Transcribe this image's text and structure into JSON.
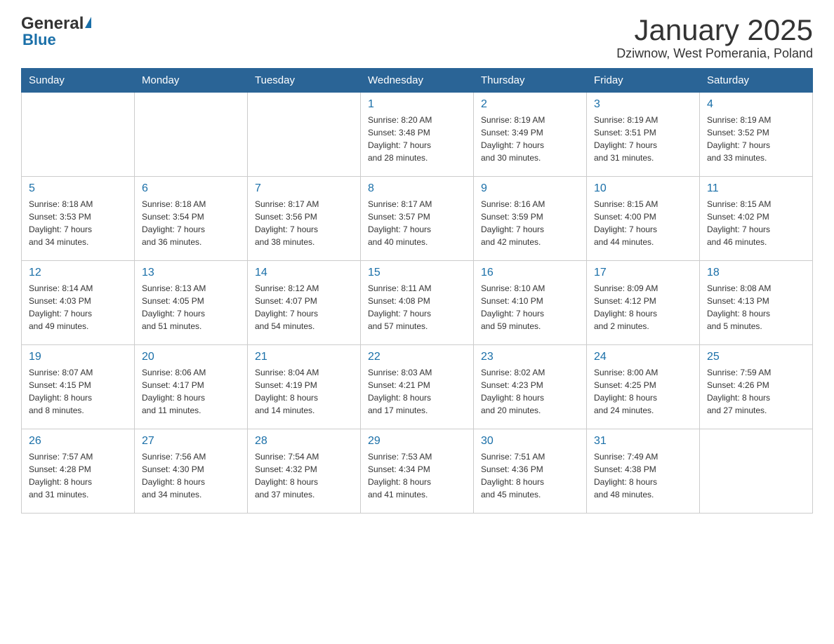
{
  "header": {
    "logo_general": "General",
    "logo_blue": "Blue",
    "title": "January 2025",
    "subtitle": "Dziwnow, West Pomerania, Poland"
  },
  "days_of_week": [
    "Sunday",
    "Monday",
    "Tuesday",
    "Wednesday",
    "Thursday",
    "Friday",
    "Saturday"
  ],
  "weeks": [
    {
      "days": [
        {
          "num": "",
          "info": ""
        },
        {
          "num": "",
          "info": ""
        },
        {
          "num": "",
          "info": ""
        },
        {
          "num": "1",
          "info": "Sunrise: 8:20 AM\nSunset: 3:48 PM\nDaylight: 7 hours\nand 28 minutes."
        },
        {
          "num": "2",
          "info": "Sunrise: 8:19 AM\nSunset: 3:49 PM\nDaylight: 7 hours\nand 30 minutes."
        },
        {
          "num": "3",
          "info": "Sunrise: 8:19 AM\nSunset: 3:51 PM\nDaylight: 7 hours\nand 31 minutes."
        },
        {
          "num": "4",
          "info": "Sunrise: 8:19 AM\nSunset: 3:52 PM\nDaylight: 7 hours\nand 33 minutes."
        }
      ]
    },
    {
      "days": [
        {
          "num": "5",
          "info": "Sunrise: 8:18 AM\nSunset: 3:53 PM\nDaylight: 7 hours\nand 34 minutes."
        },
        {
          "num": "6",
          "info": "Sunrise: 8:18 AM\nSunset: 3:54 PM\nDaylight: 7 hours\nand 36 minutes."
        },
        {
          "num": "7",
          "info": "Sunrise: 8:17 AM\nSunset: 3:56 PM\nDaylight: 7 hours\nand 38 minutes."
        },
        {
          "num": "8",
          "info": "Sunrise: 8:17 AM\nSunset: 3:57 PM\nDaylight: 7 hours\nand 40 minutes."
        },
        {
          "num": "9",
          "info": "Sunrise: 8:16 AM\nSunset: 3:59 PM\nDaylight: 7 hours\nand 42 minutes."
        },
        {
          "num": "10",
          "info": "Sunrise: 8:15 AM\nSunset: 4:00 PM\nDaylight: 7 hours\nand 44 minutes."
        },
        {
          "num": "11",
          "info": "Sunrise: 8:15 AM\nSunset: 4:02 PM\nDaylight: 7 hours\nand 46 minutes."
        }
      ]
    },
    {
      "days": [
        {
          "num": "12",
          "info": "Sunrise: 8:14 AM\nSunset: 4:03 PM\nDaylight: 7 hours\nand 49 minutes."
        },
        {
          "num": "13",
          "info": "Sunrise: 8:13 AM\nSunset: 4:05 PM\nDaylight: 7 hours\nand 51 minutes."
        },
        {
          "num": "14",
          "info": "Sunrise: 8:12 AM\nSunset: 4:07 PM\nDaylight: 7 hours\nand 54 minutes."
        },
        {
          "num": "15",
          "info": "Sunrise: 8:11 AM\nSunset: 4:08 PM\nDaylight: 7 hours\nand 57 minutes."
        },
        {
          "num": "16",
          "info": "Sunrise: 8:10 AM\nSunset: 4:10 PM\nDaylight: 7 hours\nand 59 minutes."
        },
        {
          "num": "17",
          "info": "Sunrise: 8:09 AM\nSunset: 4:12 PM\nDaylight: 8 hours\nand 2 minutes."
        },
        {
          "num": "18",
          "info": "Sunrise: 8:08 AM\nSunset: 4:13 PM\nDaylight: 8 hours\nand 5 minutes."
        }
      ]
    },
    {
      "days": [
        {
          "num": "19",
          "info": "Sunrise: 8:07 AM\nSunset: 4:15 PM\nDaylight: 8 hours\nand 8 minutes."
        },
        {
          "num": "20",
          "info": "Sunrise: 8:06 AM\nSunset: 4:17 PM\nDaylight: 8 hours\nand 11 minutes."
        },
        {
          "num": "21",
          "info": "Sunrise: 8:04 AM\nSunset: 4:19 PM\nDaylight: 8 hours\nand 14 minutes."
        },
        {
          "num": "22",
          "info": "Sunrise: 8:03 AM\nSunset: 4:21 PM\nDaylight: 8 hours\nand 17 minutes."
        },
        {
          "num": "23",
          "info": "Sunrise: 8:02 AM\nSunset: 4:23 PM\nDaylight: 8 hours\nand 20 minutes."
        },
        {
          "num": "24",
          "info": "Sunrise: 8:00 AM\nSunset: 4:25 PM\nDaylight: 8 hours\nand 24 minutes."
        },
        {
          "num": "25",
          "info": "Sunrise: 7:59 AM\nSunset: 4:26 PM\nDaylight: 8 hours\nand 27 minutes."
        }
      ]
    },
    {
      "days": [
        {
          "num": "26",
          "info": "Sunrise: 7:57 AM\nSunset: 4:28 PM\nDaylight: 8 hours\nand 31 minutes."
        },
        {
          "num": "27",
          "info": "Sunrise: 7:56 AM\nSunset: 4:30 PM\nDaylight: 8 hours\nand 34 minutes."
        },
        {
          "num": "28",
          "info": "Sunrise: 7:54 AM\nSunset: 4:32 PM\nDaylight: 8 hours\nand 37 minutes."
        },
        {
          "num": "29",
          "info": "Sunrise: 7:53 AM\nSunset: 4:34 PM\nDaylight: 8 hours\nand 41 minutes."
        },
        {
          "num": "30",
          "info": "Sunrise: 7:51 AM\nSunset: 4:36 PM\nDaylight: 8 hours\nand 45 minutes."
        },
        {
          "num": "31",
          "info": "Sunrise: 7:49 AM\nSunset: 4:38 PM\nDaylight: 8 hours\nand 48 minutes."
        },
        {
          "num": "",
          "info": ""
        }
      ]
    }
  ]
}
